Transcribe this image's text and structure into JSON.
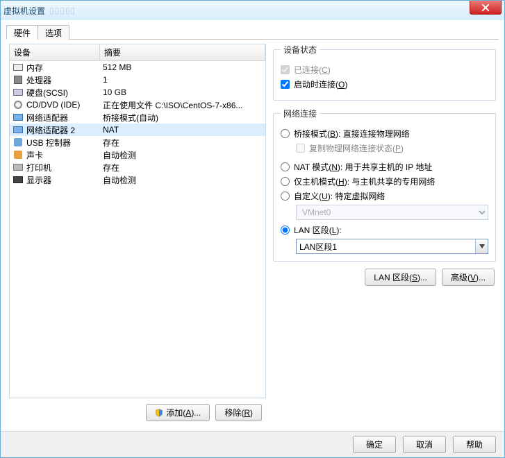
{
  "window": {
    "title": "虚拟机设置"
  },
  "tabs": {
    "hardware": "硬件",
    "options": "选项"
  },
  "list": {
    "head_device": "设备",
    "head_summary": "摘要",
    "items": [
      {
        "icon": "mem",
        "name": "内存",
        "summary": "512 MB"
      },
      {
        "icon": "cpu",
        "name": "处理器",
        "summary": "1"
      },
      {
        "icon": "disk",
        "name": "硬盘(SCSI)",
        "summary": "10 GB"
      },
      {
        "icon": "cd",
        "name": "CD/DVD (IDE)",
        "summary": "正在使用文件 C:\\ISO\\CentOS-7-x86..."
      },
      {
        "icon": "net",
        "name": "网络适配器",
        "summary": "桥接模式(自动)"
      },
      {
        "icon": "net",
        "name": "网络适配器 2",
        "summary": "NAT",
        "selected": true
      },
      {
        "icon": "usb",
        "name": "USB 控制器",
        "summary": "存在"
      },
      {
        "icon": "snd",
        "name": "声卡",
        "summary": "自动检测"
      },
      {
        "icon": "prn",
        "name": "打印机",
        "summary": "存在"
      },
      {
        "icon": "mon",
        "name": "显示器",
        "summary": "自动检测"
      }
    ]
  },
  "buttons": {
    "add": {
      "label": "添加",
      "accel": "A"
    },
    "remove": {
      "label": "移除",
      "accel": "R"
    },
    "lanseg": {
      "label": "LAN 区段",
      "accel": "S"
    },
    "adv": {
      "label": "高级",
      "accel": "V"
    },
    "ok": "确定",
    "cancel": "取消",
    "help": "帮助"
  },
  "device_status": {
    "legend": "设备状态",
    "connected": {
      "label": "已连接",
      "accel": "C",
      "checked": true,
      "disabled": true
    },
    "connect_power": {
      "label": "启动时连接",
      "accel": "O",
      "checked": true
    }
  },
  "network": {
    "legend": "网络连接",
    "bridged": {
      "label": "桥接模式",
      "accel": "B",
      "suffix": ": 直接连接物理网络"
    },
    "replicate": {
      "label": "复制物理网络连接状态",
      "accel": "P",
      "disabled": true
    },
    "nat": {
      "label": "NAT 模式",
      "accel": "N",
      "suffix": ": 用于共享主机的 IP 地址"
    },
    "hostonly": {
      "label": "仅主机模式",
      "accel": "H",
      "suffix": ": 与主机共享的专用网络"
    },
    "custom": {
      "label": "自定义",
      "accel": "U",
      "suffix": ": 特定虚拟网络"
    },
    "custom_val": "VMnet0",
    "lan": {
      "label": "LAN 区段",
      "accel": "L",
      "suffix": ":"
    },
    "lan_val": "LAN区段1",
    "selected": "lan"
  }
}
